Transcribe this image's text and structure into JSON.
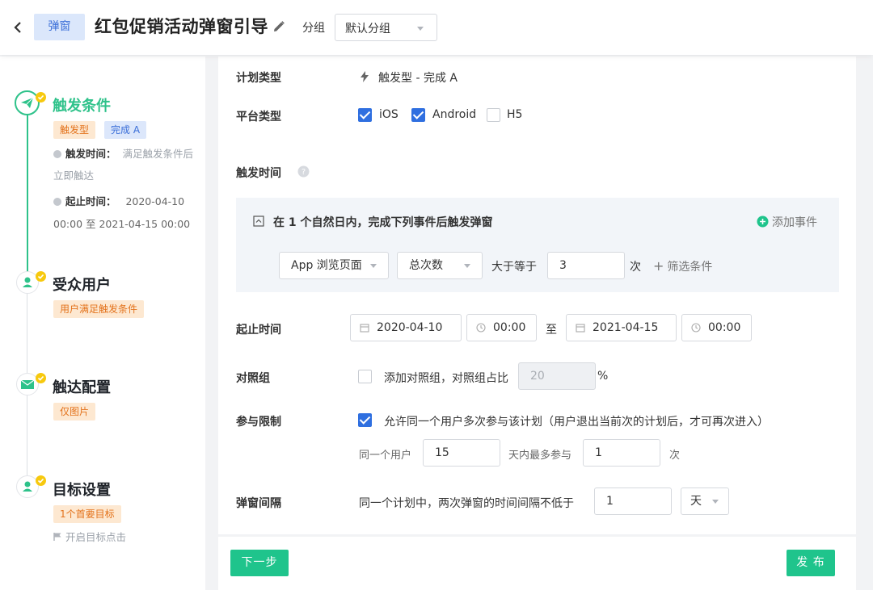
{
  "header": {
    "tag": "弹窗",
    "title": "红包促销活动弹窗引导",
    "group_label": "分组",
    "group_value": "默认分组"
  },
  "sidebar": {
    "step1": {
      "title": "触发条件",
      "badges": [
        "触发型",
        "完成 A"
      ],
      "trigger_label": "触发时间：",
      "trigger_value_1": "满足触发条件后",
      "trigger_value_2": "立即触达",
      "period_label": "起止时间：",
      "period_value_1": "2020-04-10",
      "period_value_2": "00:00 至 2021-04-15 00:00"
    },
    "step2": {
      "title": "受众用户",
      "badge": "用户满足触发条件"
    },
    "step3": {
      "title": "触达配置",
      "badge": "仅图片"
    },
    "step4": {
      "title": "目标设置",
      "badge": "1个首要目标",
      "link": "开启目标点击"
    }
  },
  "form": {
    "plan_type_label": "计划类型",
    "plan_type_value": "触发型 - 完成 A",
    "platform_label": "平台类型",
    "platforms": [
      {
        "name": "iOS",
        "checked": true
      },
      {
        "name": "Android",
        "checked": true
      },
      {
        "name": "H5",
        "checked": false
      }
    ],
    "trigger_time_label": "触发时间",
    "panel": {
      "title": "在 1 个自然日内，完成下列事件后触发弹窗",
      "add_event": "添加事件",
      "event": "App 浏览页面",
      "metric": "总次数",
      "operator": "大于等于",
      "count": "3",
      "unit": "次",
      "add_filter": "筛选条件"
    },
    "period_label": "起止时间",
    "start_date": "2020-04-10",
    "start_time": "00:00",
    "to": "至",
    "end_date": "2021-04-15",
    "end_time": "00:00",
    "control_label": "对照组",
    "control_text": "添加对照组，对照组占比",
    "control_value": "20",
    "control_unit": "%",
    "limit_label": "参与限制",
    "limit_text": "允许同一个用户多次参与该计划（用户退出当前次的计划后，才可再次进入）",
    "limit_user": "同一个用户",
    "limit_days": "15",
    "limit_within": "天内最多参与",
    "limit_times": "1",
    "limit_unit": "次",
    "interval_label": "弹窗间隔",
    "interval_text": "同一个计划中，两次弹窗的时间间隔不低于",
    "interval_value": "1",
    "interval_unit": "天"
  },
  "footer": {
    "next": "下一步",
    "publish": "发 布"
  },
  "colors": {
    "green": "#2ec28a",
    "blue": "#2f6fe0",
    "orange": "#e3721b",
    "yellow": "#f7c90e"
  }
}
